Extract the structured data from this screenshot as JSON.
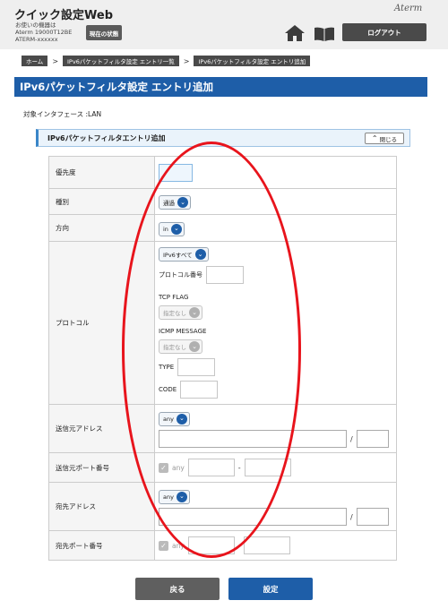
{
  "header": {
    "title": "クイック設定Web",
    "device_line1": "お使いの機器は",
    "device_line2": "Aterm 19000T12BE",
    "device_line3": "ATERM-xxxxxx",
    "status_button": "現在の状態",
    "brand": "Aterm",
    "logout_button": "ログアウト",
    "icons": [
      "home-icon",
      "book-icon"
    ]
  },
  "breadcrumb": {
    "items": [
      "ホーム",
      "IPv6パケットフィルタ設定 エントリ一覧",
      "IPv6パケットフィルタ設定 エントリ追加"
    ],
    "separator": ">"
  },
  "page_title": "IPv6パケットフィルタ設定 エントリ追加",
  "interface_label": "対象インタフェース :LAN",
  "section": {
    "title": "IPv6パケットフィルタエントリ追加",
    "close_button": "閉じる"
  },
  "form": {
    "priority": {
      "label": "優先度",
      "value": ""
    },
    "type": {
      "label": "種別",
      "value": "通過"
    },
    "direction": {
      "label": "方向",
      "value": "in"
    },
    "protocol": {
      "label": "プロトコル",
      "value": "IPv6すべて",
      "number_label": "プロトコル番号",
      "tcp_flag_label": "TCP FLAG",
      "tcp_flag_value": "指定なし",
      "icmp_label": "ICMP MESSAGE",
      "icmp_value": "指定なし",
      "type_label": "TYPE",
      "code_label": "CODE"
    },
    "src_address": {
      "label": "送信元アドレス",
      "value": "any",
      "slash": "/"
    },
    "src_port": {
      "label": "送信元ポート番号",
      "any_label": "any",
      "dash": "-"
    },
    "dst_address": {
      "label": "宛先アドレス",
      "value": "any",
      "slash": "/"
    },
    "dst_port": {
      "label": "宛先ポート番号",
      "any_label": "any"
    }
  },
  "buttons": {
    "back": "戻る",
    "submit": "設定"
  },
  "colors": {
    "primary": "#1e5ea8",
    "annotation_red": "#e8141c",
    "dark_button": "#5f5f5f"
  }
}
